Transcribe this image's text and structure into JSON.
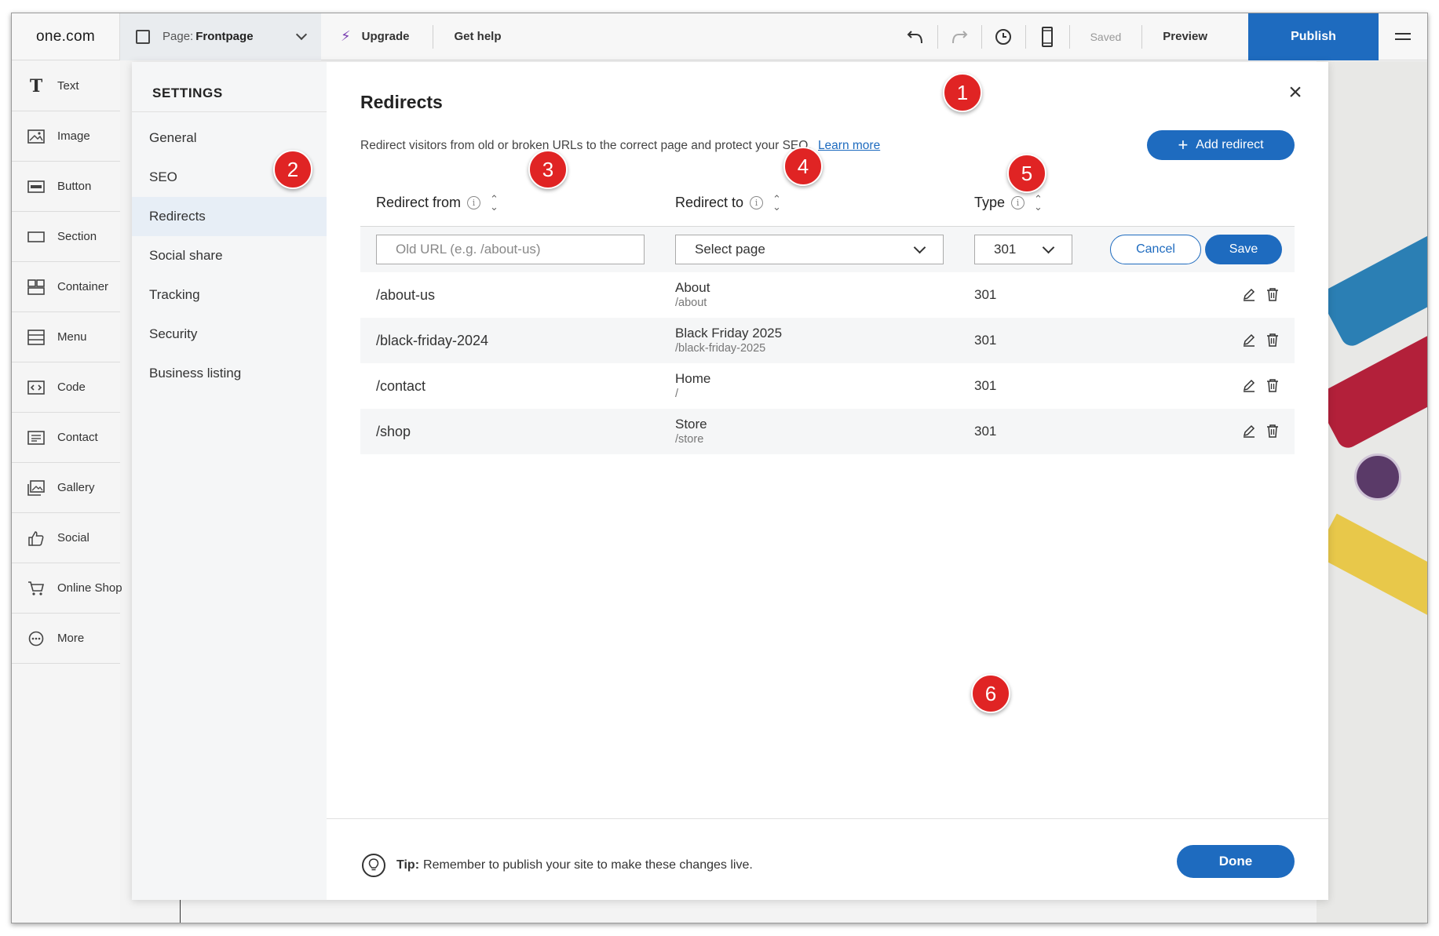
{
  "topbar": {
    "logo": "one.com",
    "page_label": "Page:",
    "page_value": "Frontpage",
    "upgrade": "Upgrade",
    "get_help": "Get help",
    "saved": "Saved",
    "preview": "Preview",
    "publish": "Publish"
  },
  "tools": [
    {
      "label": "Text",
      "icon": "text-icon"
    },
    {
      "label": "Image",
      "icon": "image-icon"
    },
    {
      "label": "Button",
      "icon": "button-icon"
    },
    {
      "label": "Section",
      "icon": "section-icon"
    },
    {
      "label": "Container",
      "icon": "container-icon"
    },
    {
      "label": "Menu",
      "icon": "menu-icon"
    },
    {
      "label": "Code",
      "icon": "code-icon"
    },
    {
      "label": "Contact",
      "icon": "contact-icon"
    },
    {
      "label": "Gallery",
      "icon": "gallery-icon"
    },
    {
      "label": "Social",
      "icon": "thumbs-up-icon"
    },
    {
      "label": "Online Shop",
      "icon": "cart-icon"
    },
    {
      "label": "More",
      "icon": "more-icon"
    }
  ],
  "settings": {
    "title": "SETTINGS",
    "nav": [
      "General",
      "SEO",
      "Redirects",
      "Social share",
      "Tracking",
      "Security",
      "Business listing"
    ],
    "active": "Redirects"
  },
  "redirects": {
    "title": "Redirects",
    "description": "Redirect visitors from old or broken URLs to the correct page and protect your SEO.",
    "learn_more": "Learn more",
    "add_button": "Add redirect",
    "columns": {
      "from": "Redirect from",
      "to": "Redirect to",
      "type": "Type"
    },
    "form": {
      "url_placeholder": "Old URL (e.g. /about-us)",
      "page_select": "Select page",
      "type_select": "301",
      "cancel": "Cancel",
      "save": "Save"
    },
    "rows": [
      {
        "from": "/about-us",
        "to_name": "About",
        "to_path": "/about",
        "type": "301"
      },
      {
        "from": "/black-friday-2024",
        "to_name": "Black Friday 2025",
        "to_path": "/black-friday-2025",
        "type": "301"
      },
      {
        "from": "/contact",
        "to_name": "Home",
        "to_path": "/",
        "type": "301"
      },
      {
        "from": "/shop",
        "to_name": "Store",
        "to_path": "/store",
        "type": "301"
      }
    ]
  },
  "footer": {
    "tip_label": "Tip:",
    "tip_text": "Remember to publish your site to make these changes live.",
    "done": "Done"
  },
  "markers": [
    "1",
    "2",
    "3",
    "4",
    "5",
    "6"
  ],
  "colors": {
    "accent": "#1e6bbf",
    "marker": "#e02424",
    "active_nav": "#e7eef6"
  }
}
